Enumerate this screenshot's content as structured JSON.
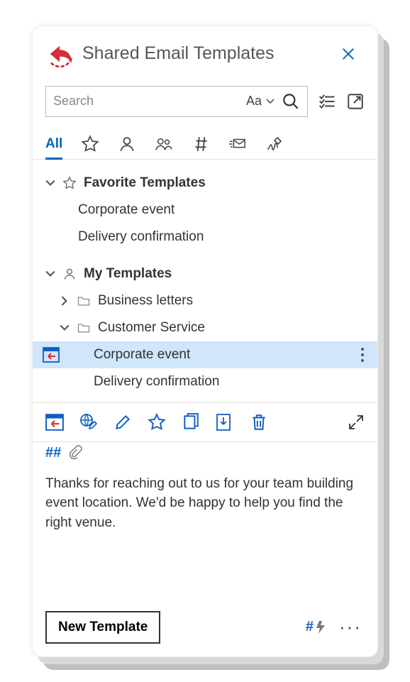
{
  "header": {
    "title": "Shared Email Templates"
  },
  "search": {
    "placeholder": "Search",
    "case_label": "Aa"
  },
  "filters": {
    "all_label": "All"
  },
  "tree": {
    "favorites": {
      "label": "Favorite Templates",
      "items": [
        "Corporate event",
        "Delivery confirmation"
      ]
    },
    "my": {
      "label": "My Templates",
      "folders": [
        {
          "label": "Business letters",
          "expanded": false
        },
        {
          "label": "Customer Service",
          "expanded": true,
          "items": [
            "Corporate event",
            "Delivery confirmation"
          ],
          "selected_index": 0
        }
      ]
    }
  },
  "meta": {
    "hash_label": "##"
  },
  "preview": {
    "body": "Thanks for reaching out to us for your team building event location. We'd be happy to help you find the right venue."
  },
  "footer": {
    "new_label": "New Template",
    "ai_label": "#"
  }
}
